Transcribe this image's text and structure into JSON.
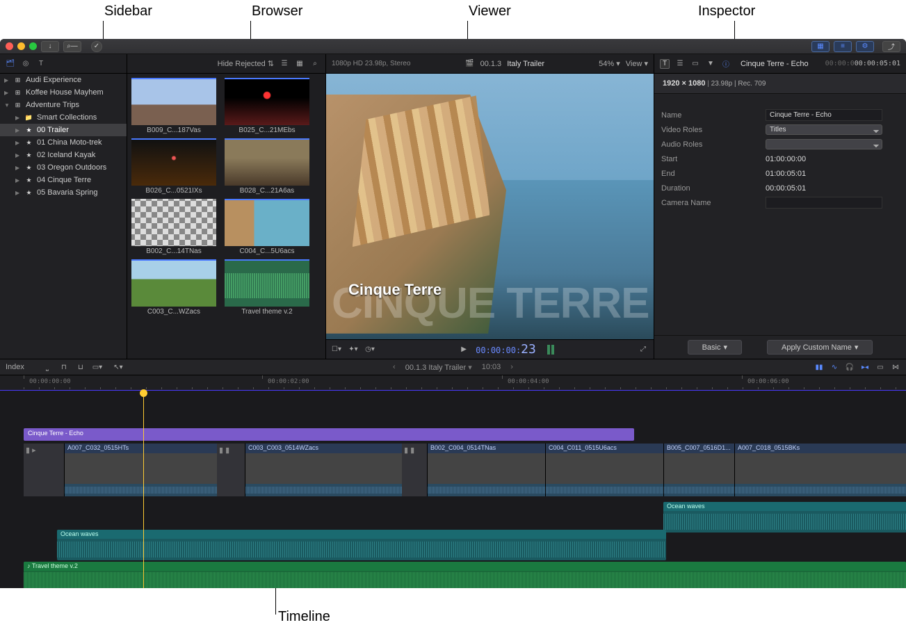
{
  "annotations": {
    "sidebar": "Sidebar",
    "browser": "Browser",
    "viewer": "Viewer",
    "inspector": "Inspector",
    "timeline": "Timeline"
  },
  "header": {
    "hide_rejected": "Hide Rejected",
    "format": "1080p HD 23.98p, Stereo",
    "proj_code": "00.1.3",
    "proj_name": "Italy Trailer",
    "zoom": "54%",
    "view": "View",
    "insp_title": "Cinque Terre - Echo",
    "insp_tc": "00:00:05:01"
  },
  "sidebar": {
    "items": [
      {
        "label": "Audi Experience",
        "icon": "grid"
      },
      {
        "label": "Koffee House Mayhem",
        "icon": "grid"
      },
      {
        "label": "Adventure Trips",
        "icon": "grid",
        "open": true
      },
      {
        "label": "Smart Collections",
        "icon": "folder",
        "child": true
      },
      {
        "label": "00 Trailer",
        "icon": "star",
        "child": true,
        "selected": true
      },
      {
        "label": "01 China Moto-trek",
        "icon": "star",
        "child": true
      },
      {
        "label": "02 Iceland Kayak",
        "icon": "star",
        "child": true
      },
      {
        "label": "03 Oregon Outdoors",
        "icon": "star",
        "child": true
      },
      {
        "label": "04 Cinque Terre",
        "icon": "star",
        "child": true
      },
      {
        "label": "05 Bavaria Spring",
        "icon": "star",
        "child": true
      }
    ]
  },
  "browser": {
    "clips": [
      {
        "label": "B009_C...187Vas",
        "thumb": "mountain"
      },
      {
        "label": "B025_C...21MEbs",
        "thumb": "red"
      },
      {
        "label": "B026_C...0521IXs",
        "thumb": "dark"
      },
      {
        "label": "B028_C...21A6as",
        "thumb": "hall"
      },
      {
        "label": "B002_C...14TNas",
        "thumb": "checker"
      },
      {
        "label": "C004_C...5U6acs",
        "thumb": "town"
      },
      {
        "label": "C003_C...WZacs",
        "thumb": "trees"
      },
      {
        "label": "Travel theme v.2",
        "thumb": "audio"
      }
    ]
  },
  "viewer": {
    "title_overlay": "Cinque Terre",
    "title_bg": "CINQUE TERRE",
    "tc_prefix": "00:00:00:",
    "tc_frames": "23"
  },
  "inspector": {
    "dims": "1920 × 1080",
    "meta": "23.98p | Rec. 709",
    "rows": {
      "name_label": "Name",
      "name_value": "Cinque Terre - Echo",
      "video_roles_label": "Video Roles",
      "video_roles_value": "Titles",
      "audio_roles_label": "Audio Roles",
      "audio_roles_value": "",
      "start_label": "Start",
      "start_value": "01:00:00:00",
      "end_label": "End",
      "end_value": "01:00:05:01",
      "duration_label": "Duration",
      "duration_value": "00:00:05:01",
      "camera_label": "Camera Name",
      "camera_value": ""
    },
    "footer": {
      "basic": "Basic",
      "apply": "Apply Custom Name"
    }
  },
  "tl_toolbar": {
    "index": "Index",
    "center_proj": "00.1.3  Italy Trailer",
    "center_dur": "10:03"
  },
  "timeline": {
    "ruler": [
      "00:00:00:00",
      "00:00:02:00",
      "00:00:04:00",
      "00:00:06:00"
    ],
    "title_clip": "Cinque Terre - Echo",
    "video_clips": [
      {
        "label": "A007_C032_0515HTs",
        "film": "town"
      },
      {
        "label": "C003_C003_0514WZacs",
        "film": "trees"
      },
      {
        "label": "B002_C004_0514TNas",
        "film": "check"
      },
      {
        "label": "C004_C011_0515U6acs",
        "film": "arch"
      },
      {
        "label": "B005_C007_0516D1...",
        "film": "int"
      },
      {
        "label": "A007_C018_0515BKs",
        "film": "town2"
      }
    ],
    "audio1": "Ocean waves",
    "audio2": "Ocean waves",
    "music": "Travel theme v.2"
  }
}
